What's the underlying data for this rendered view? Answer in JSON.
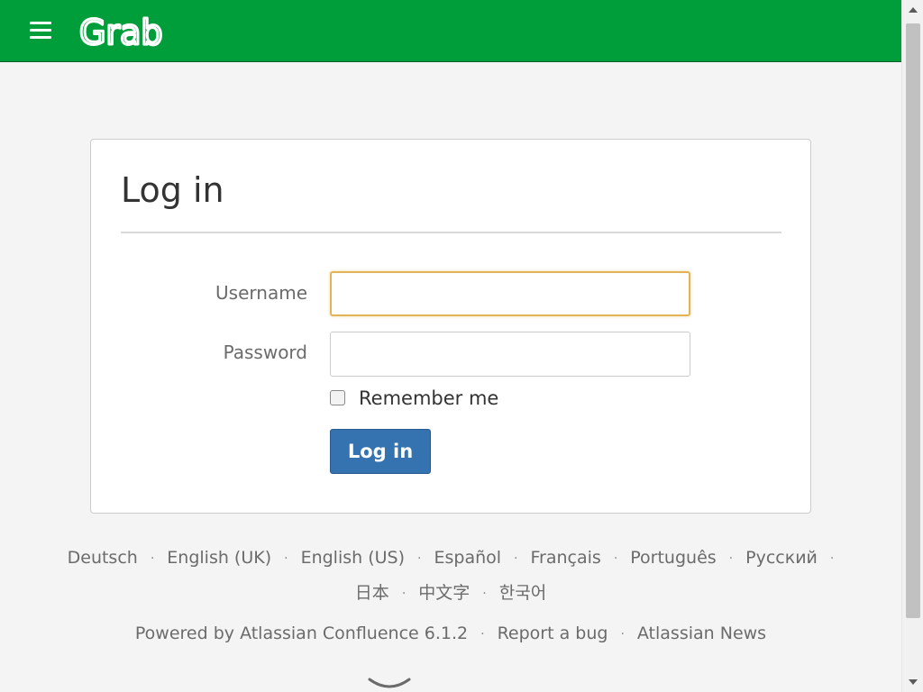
{
  "header": {
    "menu_icon": "hamburger-menu-icon",
    "logo_text": "Grab",
    "background_color": "#009d3b"
  },
  "login": {
    "title": "Log in",
    "username_label": "Username",
    "username_value": "",
    "password_label": "Password",
    "password_value": "",
    "remember_label": "Remember me",
    "remember_checked": false,
    "submit_label": "Log in",
    "button_color": "#3572b0",
    "focus_color": "#e3b456"
  },
  "footer": {
    "languages": [
      "Deutsch",
      "English (UK)",
      "English (US)",
      "Español",
      "Français",
      "Português",
      "Русский",
      "日本",
      "中文字",
      "한국어"
    ],
    "separator": "·",
    "powered_by": "Powered by Atlassian Confluence 6.1.2",
    "report_bug": "Report a bug",
    "news": "Atlassian News"
  }
}
